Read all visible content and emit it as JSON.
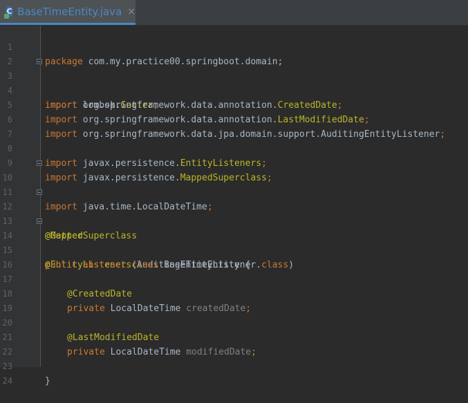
{
  "tab": {
    "icon_letter": "C",
    "title": "BaseTimeEntity.java",
    "close_glyph": "×"
  },
  "colors": {
    "keyword": "#cc7832",
    "annotation": "#bbb529",
    "text": "#a9b7c6",
    "unused": "#808080",
    "tab_accent": "#4a88c7"
  },
  "code": {
    "l1": {
      "n": "1",
      "kw": "package",
      "rest": " com.my.practice00.springboot.domain;"
    },
    "l2": {
      "n": "2"
    },
    "l3": {
      "n": "3",
      "kw": "import",
      "pkg": " lombok.",
      "cls": "Getter",
      "semi": ";"
    },
    "l4": {
      "n": "4",
      "kw": "import",
      "pkg": " org.springframework.data.annotation.",
      "cls": "CreatedDate",
      "semi": ";"
    },
    "l5": {
      "n": "5",
      "kw": "import",
      "pkg": " org.springframework.data.annotation.",
      "cls": "LastModifiedDate",
      "semi": ";"
    },
    "l6": {
      "n": "6",
      "kw": "import",
      "pkg": " org.springframework.data.jpa.domain.support.AuditingEntityListener",
      "semi": ";"
    },
    "l7": {
      "n": "7"
    },
    "l8": {
      "n": "8",
      "kw": "import",
      "pkg": " javax.persistence.",
      "cls": "EntityListeners",
      "semi": ";"
    },
    "l9": {
      "n": "9",
      "kw": "import",
      "pkg": " javax.persistence.",
      "cls": "MappedSuperclass",
      "semi": ";"
    },
    "l10": {
      "n": "10",
      "kw": "import",
      "pkg": " java.time.LocalDateTime",
      "semi": ";"
    },
    "l11": {
      "n": "11"
    },
    "l12": {
      "n": "12",
      "ann": "@Getter"
    },
    "l13": {
      "n": "13",
      "ann": "@MappedSuperclass"
    },
    "l14": {
      "n": "14",
      "ann": "@EntityListeners",
      "open": "(AuditingEntityListener.",
      "kw2": "class",
      "close": ")"
    },
    "l15": {
      "n": "15",
      "kw": "public abstract class",
      "rest": " BaseTimeEntity {"
    },
    "l16": {
      "n": "16"
    },
    "l17": {
      "n": "17",
      "ann": "@CreatedDate"
    },
    "l18": {
      "n": "18",
      "kw": "private",
      "type": " LocalDateTime ",
      "field": "createdDate",
      "semi": ";"
    },
    "l19": {
      "n": "19"
    },
    "l20": {
      "n": "20",
      "ann": "@LastModifiedDate"
    },
    "l21": {
      "n": "21",
      "kw": "private",
      "type": " LocalDateTime ",
      "field": "modifiedDate",
      "semi": ";"
    },
    "l22": {
      "n": "22"
    },
    "l23": {
      "n": "23",
      "rest": "}"
    },
    "l24": {
      "n": "24"
    }
  }
}
